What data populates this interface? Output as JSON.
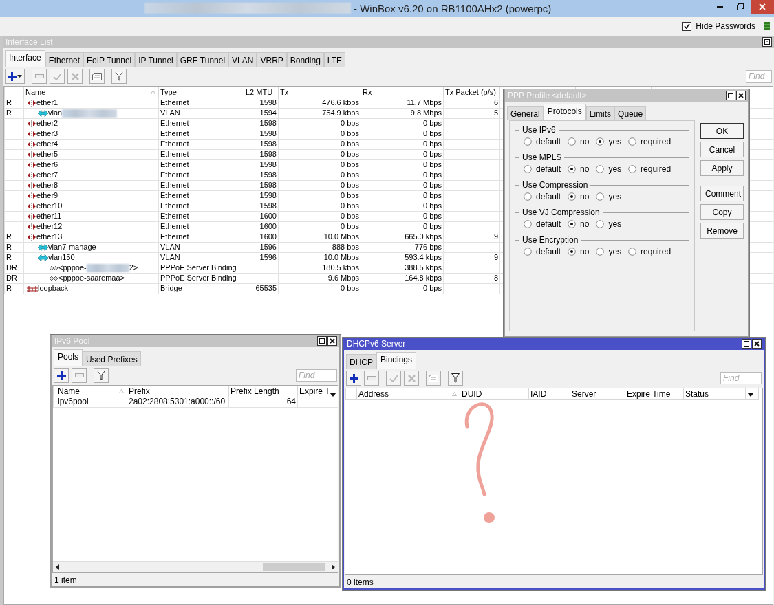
{
  "window": {
    "title": "- WinBox v6.20 on RB1100AHx2 (powerpc)",
    "title_redacted": true
  },
  "topbar": {
    "hide_passwords": {
      "label": "Hide Passwords",
      "checked": true
    }
  },
  "interface_list": {
    "title": "Interface List",
    "active": false,
    "tabs": [
      {
        "label": "Interface",
        "selected": true
      },
      {
        "label": "Ethernet",
        "selected": false
      },
      {
        "label": "EoIP Tunnel",
        "selected": false
      },
      {
        "label": "IP Tunnel",
        "selected": false
      },
      {
        "label": "GRE Tunnel",
        "selected": false
      },
      {
        "label": "VLAN",
        "selected": false
      },
      {
        "label": "VRRP",
        "selected": false
      },
      {
        "label": "Bonding",
        "selected": false
      },
      {
        "label": "LTE",
        "selected": false
      }
    ],
    "find_placeholder": "Find",
    "columns": [
      "Name",
      "Type",
      "L2 MTU",
      "Tx",
      "Rx",
      "Tx Packet (p/s)"
    ],
    "rows": [
      {
        "flags": "R",
        "kind": "ethernet",
        "name": "ether1",
        "type": "Ethernet",
        "l2mtu": "1598",
        "tx": "476.6 kbps",
        "rx": "11.7 Mbps",
        "tx_packet": "6",
        "children": [
          {
            "flags": "R",
            "kind": "vlan",
            "name": "vlan",
            "redacted": true,
            "type": "VLAN",
            "l2mtu": "1594",
            "tx": "754.9 kbps",
            "rx": "9.8 Mbps",
            "tx_packet": "5"
          }
        ]
      },
      {
        "kind": "ethernet",
        "name": "ether2",
        "type": "Ethernet",
        "l2mtu": "1598",
        "tx": "0 bps",
        "rx": "0 bps"
      },
      {
        "kind": "ethernet",
        "name": "ether3",
        "type": "Ethernet",
        "l2mtu": "1598",
        "tx": "0 bps",
        "rx": "0 bps"
      },
      {
        "kind": "ethernet",
        "name": "ether4",
        "type": "Ethernet",
        "l2mtu": "1598",
        "tx": "0 bps",
        "rx": "0 bps"
      },
      {
        "kind": "ethernet",
        "name": "ether5",
        "type": "Ethernet",
        "l2mtu": "1598",
        "tx": "0 bps",
        "rx": "0 bps"
      },
      {
        "kind": "ethernet",
        "name": "ether6",
        "type": "Ethernet",
        "l2mtu": "1598",
        "tx": "0 bps",
        "rx": "0 bps"
      },
      {
        "kind": "ethernet",
        "name": "ether7",
        "type": "Ethernet",
        "l2mtu": "1598",
        "tx": "0 bps",
        "rx": "0 bps"
      },
      {
        "kind": "ethernet",
        "name": "ether8",
        "type": "Ethernet",
        "l2mtu": "1598",
        "tx": "0 bps",
        "rx": "0 bps"
      },
      {
        "kind": "ethernet",
        "name": "ether9",
        "type": "Ethernet",
        "l2mtu": "1598",
        "tx": "0 bps",
        "rx": "0 bps"
      },
      {
        "kind": "ethernet",
        "name": "ether10",
        "type": "Ethernet",
        "l2mtu": "1598",
        "tx": "0 bps",
        "rx": "0 bps"
      },
      {
        "kind": "ethernet",
        "name": "ether11",
        "type": "Ethernet",
        "l2mtu": "1600",
        "tx": "0 bps",
        "rx": "0 bps"
      },
      {
        "kind": "ethernet",
        "name": "ether12",
        "type": "Ethernet",
        "l2mtu": "1600",
        "tx": "0 bps",
        "rx": "0 bps"
      },
      {
        "flags": "R",
        "kind": "ethernet",
        "name": "ether13",
        "type": "Ethernet",
        "l2mtu": "1600",
        "tx": "10.0 Mbps",
        "rx": "665.0 kbps",
        "tx_packet": "9",
        "children": [
          {
            "flags": "R",
            "kind": "vlan",
            "name": "vlan7-manage",
            "type": "VLAN",
            "l2mtu": "1596",
            "tx": "888 bps",
            "rx": "776 bps"
          },
          {
            "flags": "R",
            "kind": "vlan",
            "name": "vlan150",
            "type": "VLAN",
            "l2mtu": "1596",
            "tx": "10.0 Mbps",
            "rx": "593.4 kbps",
            "tx_packet": "9",
            "children": [
              {
                "flags": "DR",
                "kind": "pppoe",
                "name": "<pppoe-",
                "redacted": true,
                "suffix": "2>",
                "type": "PPPoE Server Binding",
                "tx": "180.5 kbps",
                "rx": "388.5 kbps"
              },
              {
                "flags": "DR",
                "kind": "pppoe",
                "name": "<pppoe-saaremaa>",
                "type": "PPPoE Server Binding",
                "tx": "9.6 Mbps",
                "rx": "164.8 kbps",
                "tx_packet": "8"
              }
            ]
          }
        ]
      },
      {
        "flags": "R",
        "kind": "bridge",
        "name": "loopback",
        "type": "Bridge",
        "l2mtu": "65535",
        "tx": "0 bps",
        "rx": "0 bps"
      }
    ]
  },
  "ppp_profile": {
    "title": "PPP Profile <default>",
    "active": false,
    "tabs": [
      {
        "label": "General",
        "selected": false
      },
      {
        "label": "Protocols",
        "selected": true
      },
      {
        "label": "Limits",
        "selected": false
      },
      {
        "label": "Queue",
        "selected": false
      }
    ],
    "groups": [
      {
        "label": "Use IPv6",
        "options": [
          {
            "label": "default",
            "selected": false
          },
          {
            "label": "no",
            "selected": false
          },
          {
            "label": "yes",
            "selected": true
          },
          {
            "label": "required",
            "selected": false
          }
        ]
      },
      {
        "label": "Use MPLS",
        "options": [
          {
            "label": "default",
            "selected": false
          },
          {
            "label": "no",
            "selected": true
          },
          {
            "label": "yes",
            "selected": false
          },
          {
            "label": "required",
            "selected": false
          }
        ]
      },
      {
        "label": "Use Compression",
        "options": [
          {
            "label": "default",
            "selected": false
          },
          {
            "label": "no",
            "selected": true
          },
          {
            "label": "yes",
            "selected": false
          }
        ]
      },
      {
        "label": "Use VJ Compression",
        "options": [
          {
            "label": "default",
            "selected": false
          },
          {
            "label": "no",
            "selected": true
          },
          {
            "label": "yes",
            "selected": false
          }
        ]
      },
      {
        "label": "Use Encryption",
        "options": [
          {
            "label": "default",
            "selected": false
          },
          {
            "label": "no",
            "selected": true
          },
          {
            "label": "yes",
            "selected": false
          },
          {
            "label": "required",
            "selected": false
          }
        ]
      }
    ],
    "button_groups": [
      [
        {
          "label": "OK",
          "default": true
        },
        {
          "label": "Cancel",
          "default": false
        },
        {
          "label": "Apply",
          "default": false
        }
      ],
      [
        {
          "label": "Comment",
          "default": false
        },
        {
          "label": "Copy",
          "default": false
        },
        {
          "label": "Remove",
          "default": false
        }
      ]
    ]
  },
  "ipv6_pool": {
    "title": "IPv6 Pool",
    "active": false,
    "tabs": [
      {
        "label": "Pools",
        "selected": true
      },
      {
        "label": "Used Prefixes",
        "selected": false
      }
    ],
    "find_placeholder": "Find",
    "columns": [
      "Name",
      "Prefix",
      "Prefix Length",
      "Expire T"
    ],
    "rows": [
      {
        "name": "ipv6pool",
        "prefix": "2a02:2808:5301:a000::/60",
        "prefix_length": "64"
      }
    ],
    "status": "1 item"
  },
  "dhcpv6_server": {
    "title": "DHCPv6 Server",
    "active": true,
    "tabs": [
      {
        "label": "DHCP",
        "selected": false
      },
      {
        "label": "Bindings",
        "selected": true
      }
    ],
    "find_placeholder": "Find",
    "columns": [
      "Address",
      "DUID",
      "IAID",
      "Server",
      "Expire Time",
      "Status"
    ],
    "status": "0 items"
  }
}
